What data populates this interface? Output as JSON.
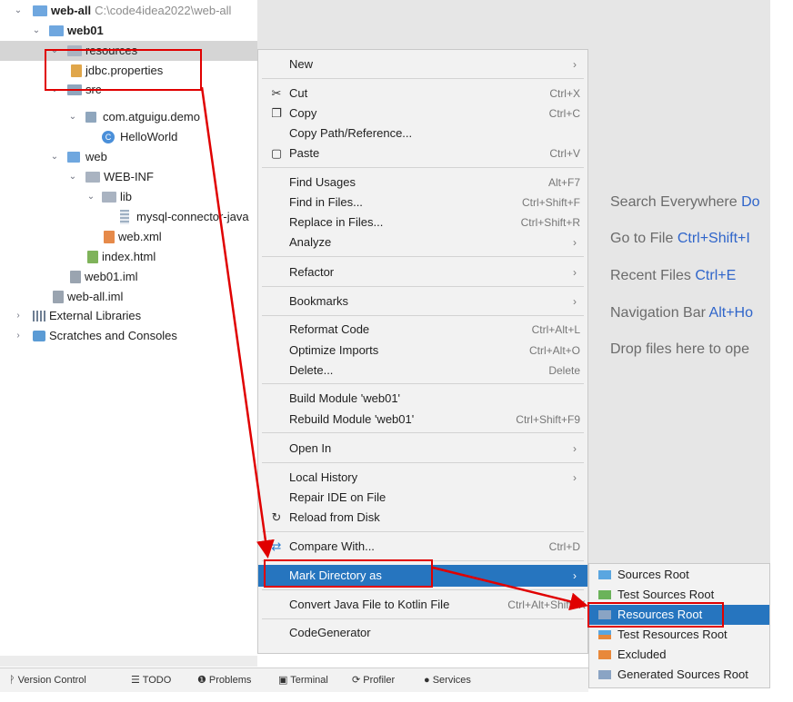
{
  "tree": {
    "project": {
      "name": "web-all",
      "path": "C:\\code4idea2022\\web-all"
    },
    "module": "web01",
    "resources": "resources",
    "jdbc": "jdbc.properties",
    "src": "src",
    "pkg": "com.atguigu.demo",
    "cls": "HelloWorld",
    "web": "web",
    "webinf": "WEB-INF",
    "lib": "lib",
    "jar": "mysql-connector-java",
    "webxml": "web.xml",
    "index": "index.html",
    "web01iml": "web01.iml",
    "weballiml": "web-all.iml",
    "extlibs": "External Libraries",
    "scratches": "Scratches and Consoles"
  },
  "hints": {
    "search": {
      "label": "Search Everywhere ",
      "key": "Do"
    },
    "goto": {
      "label": "Go to File ",
      "key": "Ctrl+Shift+I"
    },
    "recent": {
      "label": "Recent Files ",
      "key": "Ctrl+E"
    },
    "navbar": {
      "label": "Navigation Bar ",
      "key": "Alt+Ho"
    },
    "drop": {
      "label": "Drop files here to ope",
      "key": ""
    }
  },
  "menu": {
    "new": "New",
    "cut": {
      "label": "Cut",
      "shortcut": "Ctrl+X"
    },
    "copy": {
      "label": "Copy",
      "shortcut": "Ctrl+C"
    },
    "copypath": "Copy Path/Reference...",
    "paste": {
      "label": "Paste",
      "shortcut": "Ctrl+V"
    },
    "findusages": {
      "label": "Find Usages",
      "shortcut": "Alt+F7"
    },
    "findinfiles": {
      "label": "Find in Files...",
      "shortcut": "Ctrl+Shift+F"
    },
    "replace": {
      "label": "Replace in Files...",
      "shortcut": "Ctrl+Shift+R"
    },
    "analyze": "Analyze",
    "refactor": "Refactor",
    "bookmarks": "Bookmarks",
    "reformat": {
      "label": "Reformat Code",
      "shortcut": "Ctrl+Alt+L"
    },
    "optimize": {
      "label": "Optimize Imports",
      "shortcut": "Ctrl+Alt+O"
    },
    "delete": {
      "label": "Delete...",
      "shortcut": "Delete"
    },
    "build": "Build Module 'web01'",
    "rebuild": {
      "label": "Rebuild Module 'web01'",
      "shortcut": "Ctrl+Shift+F9"
    },
    "openin": "Open In",
    "localhistory": "Local History",
    "repair": "Repair IDE on File",
    "reload": "Reload from Disk",
    "compare": {
      "label": "Compare With...",
      "shortcut": "Ctrl+D"
    },
    "markdir": "Mark Directory as",
    "convert": {
      "label": "Convert Java File to Kotlin File",
      "shortcut": "Ctrl+Alt+Shift+K"
    },
    "codegen": "CodeGenerator"
  },
  "submenu": {
    "sources": "Sources Root",
    "testsources": "Test Sources Root",
    "resources": "Resources Root",
    "testresources": "Test Resources Root",
    "excluded": "Excluded",
    "generated": "Generated Sources Root"
  },
  "bottom": {
    "vcs": "Version Control",
    "todo": "TODO",
    "problems": "Problems",
    "terminal": "Terminal",
    "profiler": "Profiler",
    "services": "Services"
  },
  "colors": {
    "accent": "#2675bf",
    "annotation": "#e00000",
    "hint_key": "#2f65ca"
  }
}
